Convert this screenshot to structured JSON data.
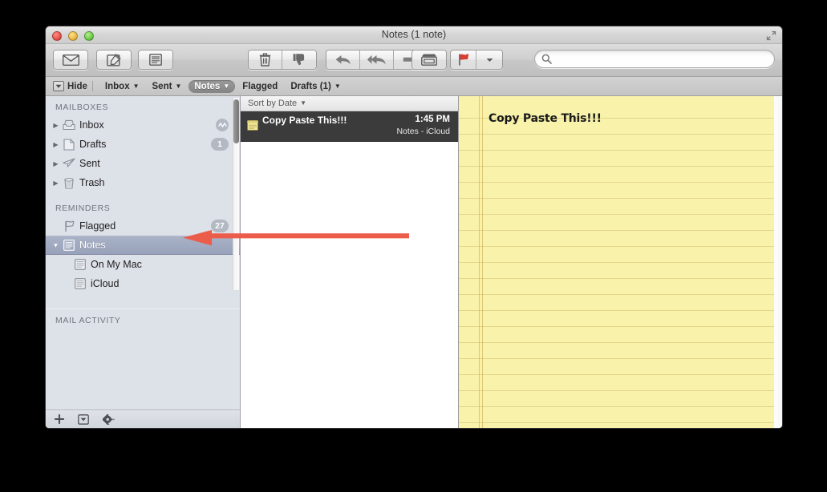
{
  "window": {
    "title": "Notes (1 note)",
    "controls": {
      "close": "close",
      "minimize": "minimize",
      "zoom": "zoom"
    }
  },
  "toolbar": {
    "buttons": [
      {
        "name": "get-mail-button",
        "icon": "envelope-icon",
        "label": "Get Mail"
      },
      {
        "name": "compose-button",
        "icon": "compose-pencil-icon",
        "label": "New Message"
      },
      {
        "name": "note-button",
        "icon": "note-lines-icon",
        "label": "New Note"
      },
      {
        "name": "delete-button",
        "icon": "trash-icon",
        "label": "Delete"
      },
      {
        "name": "junk-button",
        "icon": "thumbs-down-icon",
        "label": "Junk"
      },
      {
        "name": "reply-button",
        "icon": "reply-arrow-icon",
        "label": "Reply"
      },
      {
        "name": "reply-all-button",
        "icon": "reply-all-arrow-icon",
        "label": "Reply All"
      },
      {
        "name": "forward-button",
        "icon": "forward-arrow-icon",
        "label": "Forward"
      },
      {
        "name": "archive-button",
        "icon": "archive-box-icon",
        "label": "Archive"
      },
      {
        "name": "flag-button",
        "icon": "red-flag-icon",
        "label": "Flag"
      },
      {
        "name": "flag-dropdown-button",
        "icon": "chevron-down-icon",
        "label": "Flag Options"
      }
    ],
    "search": {
      "value": "",
      "placeholder": "",
      "icon": "search-icon"
    }
  },
  "favorites_bar": {
    "hide_label": "Hide",
    "hide_icon": "hide-box-icon",
    "items": [
      {
        "label": "Inbox",
        "has_caret": true,
        "active": false
      },
      {
        "label": "Sent",
        "has_caret": true,
        "active": false
      },
      {
        "label": "Notes",
        "has_caret": true,
        "active": true
      },
      {
        "label": "Flagged",
        "has_caret": false,
        "active": false
      },
      {
        "label": "Drafts (1)",
        "has_caret": true,
        "active": false
      }
    ]
  },
  "sidebar": {
    "sections": [
      {
        "header": "MAILBOXES",
        "items": [
          {
            "label": "Inbox",
            "icon": "inbox-tray-icon",
            "triangle": "collapsed",
            "activity": true,
            "badge": ""
          },
          {
            "label": "Drafts",
            "icon": "drafts-page-icon",
            "triangle": "collapsed",
            "activity": false,
            "badge": "1"
          },
          {
            "label": "Sent",
            "icon": "sent-plane-icon",
            "triangle": "collapsed",
            "activity": false,
            "badge": ""
          },
          {
            "label": "Trash",
            "icon": "trash-can-icon",
            "triangle": "collapsed",
            "activity": false,
            "badge": ""
          }
        ]
      },
      {
        "header": "REMINDERS",
        "items": [
          {
            "label": "Flagged",
            "icon": "flag-outline-icon",
            "triangle": "none",
            "activity": false,
            "badge": "27",
            "selected": false,
            "child": false
          },
          {
            "label": "Notes",
            "icon": "note-lines-icon",
            "triangle": "expanded",
            "activity": false,
            "badge": "",
            "selected": true,
            "child": false
          },
          {
            "label": "On My Mac",
            "icon": "note-lines-icon",
            "triangle": "none",
            "activity": false,
            "badge": "",
            "selected": false,
            "child": true
          },
          {
            "label": "iCloud",
            "icon": "note-lines-icon",
            "triangle": "none",
            "activity": false,
            "badge": "",
            "selected": false,
            "child": true
          }
        ]
      },
      {
        "header": "MAIL ACTIVITY",
        "items": []
      }
    ],
    "bottom_buttons": [
      {
        "name": "add-mailbox-button",
        "icon": "plus-icon",
        "label": "+"
      },
      {
        "name": "mailbox-actions-button",
        "icon": "dropdown-box-icon",
        "label": ""
      },
      {
        "name": "settings-gear-button",
        "icon": "gear-icon",
        "label": ""
      }
    ]
  },
  "message_list": {
    "sort_label": "Sort by Date",
    "sort_icon": "chevron-down-icon",
    "rows": [
      {
        "icon": "yellow-note-icon",
        "title": "Copy Paste This!!!",
        "time": "1:45 PM",
        "account": "Notes - iCloud",
        "selected": true
      }
    ]
  },
  "note_pane": {
    "body_text": "Copy Paste This!!!",
    "paper_color": "#f8f2ab",
    "rule_color": "#c4af5c"
  },
  "annotation": {
    "arrow": {
      "color": "#ec5c4a",
      "direction": "left",
      "points_at": "sidebar-item-notes"
    }
  }
}
